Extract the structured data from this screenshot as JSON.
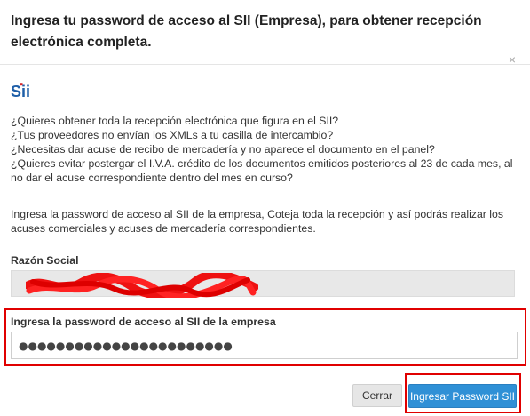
{
  "modal": {
    "title": "Ingresa tu password de acceso al SII (Empresa), para obtener recepción electrónica completa.",
    "close_symbol": "×",
    "logo": "Sii",
    "questions": [
      "¿Quieres obtener toda la recepción electrónica que figura en el SII?",
      "¿Tus proveedores no envían los XMLs a tu casilla de intercambio?",
      "¿Necesitas dar acuse de recibo de mercadería y no aparece el documento en el panel?",
      "¿Quieres evitar postergar el I.V.A. crédito de los documentos emitidos posteriores al 23 de cada mes, al no dar el acuse correspondiente dentro del mes en curso?"
    ],
    "info": "Ingresa la password de acceso al SII de la empresa, Coteja toda la recepción y así podrás realizar los acuses comerciales y acuses de mercadería correspondientes.",
    "razon_social_label": "Razón Social",
    "razon_social_value": "",
    "password_label": "Ingresa la password de acceso al SII de la empresa",
    "password_value": "●●●●●●●●●●●●●●●●●●●●●●●",
    "cancel_label": "Cerrar",
    "submit_label": "Ingresar Password SII"
  },
  "colors": {
    "primary": "#2f90d6",
    "highlight": "#e00000",
    "logo": "#1f5fa8",
    "logo_accent": "#d9262b"
  }
}
